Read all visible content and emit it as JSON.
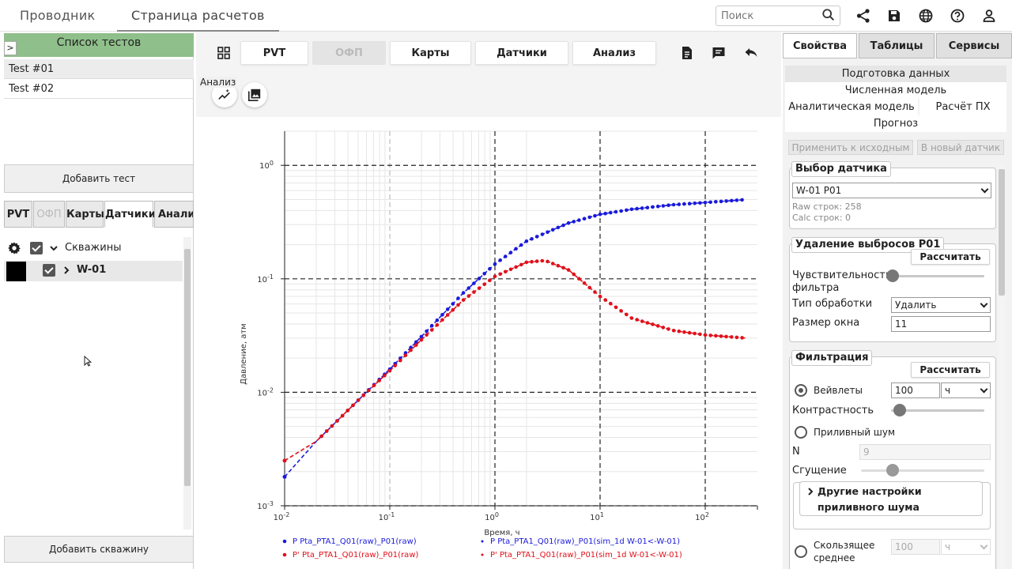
{
  "topbar": {
    "tab_explorer": "Проводник",
    "tab_calc": "Страница расчетов",
    "search_placeholder": "Поиск"
  },
  "left": {
    "list_header": "Список тестов",
    "expand_glyph": ">",
    "tests": [
      "Test #01",
      "Test #02"
    ],
    "add_test": "Добавить тест",
    "tabs": [
      {
        "label": "PVT",
        "state": "normal"
      },
      {
        "label": "ОФП",
        "state": "disabled"
      },
      {
        "label": "Карты",
        "state": "normal"
      },
      {
        "label": "Датчики",
        "state": "active"
      },
      {
        "label": "Анализ",
        "state": "normal"
      }
    ],
    "tree_root": "Скважины",
    "tree_well": "W-01",
    "well_color": "#000000",
    "add_well": "Добавить скважину"
  },
  "center": {
    "tabs": [
      {
        "label": "PVT",
        "state": "normal"
      },
      {
        "label": "ОФП",
        "state": "disabled"
      },
      {
        "label": "Карты",
        "state": "normal"
      },
      {
        "label": "Датчики",
        "state": "normal"
      },
      {
        "label": "Анализ",
        "state": "normal"
      }
    ],
    "tooltip": "Анализ"
  },
  "chart_data": {
    "type": "scatter",
    "xscale": "log",
    "yscale": "log",
    "xlim": [
      0.01,
      2.5
    ],
    "ylim": [
      0.001,
      2
    ],
    "xlabel": "Время, ч",
    "ylabel": "Давление, атм",
    "xticks": [
      "10-2",
      "10-1",
      "100",
      "101",
      "102"
    ],
    "yticks": [
      "10-3",
      "10-2",
      "10-1",
      "100"
    ],
    "legend_position": "bottom",
    "series": [
      {
        "name": "P Pta_PTA1_Q01(raw)_P01(raw)",
        "color": "#1a1adb",
        "style": "points",
        "x": [
          0.01,
          0.02,
          0.05,
          0.1,
          0.2,
          0.5,
          1,
          2,
          5,
          10,
          20,
          50,
          100,
          250
        ],
        "y": [
          0.0018,
          0.0037,
          0.0085,
          0.016,
          0.031,
          0.075,
          0.135,
          0.215,
          0.31,
          0.37,
          0.41,
          0.45,
          0.47,
          0.5
        ]
      },
      {
        "name": "P Pta_PTA1_Q01(raw)_P01(sim_1d W-01<-W-01)",
        "color": "#1a1adb",
        "style": "dashed",
        "x": [
          0.01,
          0.02,
          0.05,
          0.1,
          0.2,
          0.5,
          1,
          2,
          5,
          10,
          20,
          50,
          100,
          250
        ],
        "y": [
          0.0018,
          0.0037,
          0.0085,
          0.016,
          0.031,
          0.075,
          0.135,
          0.215,
          0.31,
          0.37,
          0.41,
          0.45,
          0.47,
          0.5
        ]
      },
      {
        "name": "P' Pta_PTA1_Q01(raw)_P01(raw)",
        "color": "#e0101a",
        "style": "points",
        "x": [
          0.01,
          0.02,
          0.05,
          0.1,
          0.2,
          0.5,
          1,
          2,
          3,
          5,
          10,
          20,
          50,
          100,
          250
        ],
        "y": [
          0.0025,
          0.0037,
          0.0085,
          0.0155,
          0.029,
          0.065,
          0.105,
          0.14,
          0.145,
          0.12,
          0.07,
          0.045,
          0.035,
          0.032,
          0.03
        ]
      },
      {
        "name": "P' Pta_PTA1_Q01(raw)_P01(sim_1d W-01<-W-01)",
        "color": "#e0101a",
        "style": "dashed",
        "x": [
          0.01,
          0.02,
          0.05,
          0.1,
          0.2,
          0.5,
          1,
          2,
          3,
          5,
          10,
          20,
          50,
          100,
          250
        ],
        "y": [
          0.0025,
          0.0037,
          0.0085,
          0.0155,
          0.029,
          0.065,
          0.105,
          0.14,
          0.145,
          0.12,
          0.07,
          0.045,
          0.035,
          0.032,
          0.03
        ]
      }
    ]
  },
  "right": {
    "tabs": [
      {
        "label": "Свойства",
        "state": "active"
      },
      {
        "label": "Таблицы",
        "state": "normal"
      },
      {
        "label": "Сервисы",
        "state": "normal"
      }
    ],
    "menu": {
      "prep": "Подготовка данных",
      "numeric": "Численная модель",
      "analytic": "Аналитическая модель",
      "px": "Расчёт ПХ",
      "forecast": "Прогноз"
    },
    "apply_source": "Применить к исходным",
    "new_sensor": "В новый датчик",
    "sensor": {
      "title": "Выбор датчика",
      "value": "W-01 P01",
      "raw_rows": "Raw строк: 258",
      "calc_rows": "Calc строк: 0"
    },
    "outliers": {
      "title": "Удаление выбросов P01",
      "calc": "Рассчитать",
      "sensitivity": "Чувствительность фильтра",
      "process_type_label": "Тип обработки",
      "process_type": "Удалить",
      "window_label": "Размер окна",
      "window": "11"
    },
    "filter": {
      "title": "Фильтрация",
      "calc": "Рассчитать",
      "wavelets": "Вейвлеты",
      "wavelet_value": "100",
      "wavelet_unit": "ч",
      "contrast": "Контрастность",
      "tidal": "Приливный шум",
      "n_label": "N",
      "n_value": "9",
      "thickening": "Сгущение",
      "more_tidal": "Другие настройки приливного шума",
      "moving_avg": "Скользящее среднее",
      "ma_value": "100",
      "ma_unit": "ч"
    }
  }
}
